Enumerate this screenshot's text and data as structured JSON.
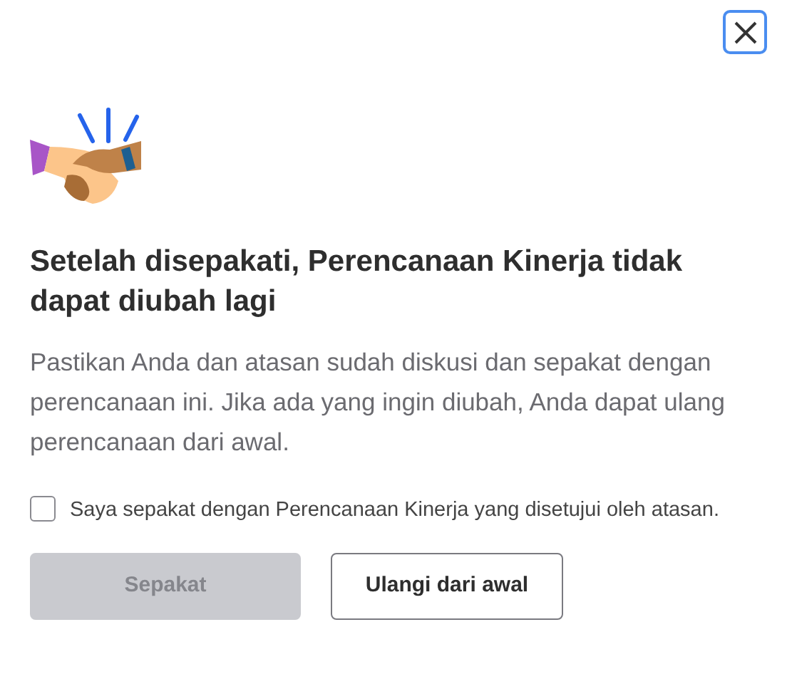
{
  "dialog": {
    "title": "Setelah disepakati, Perencanaan Kinerja tidak dapat diubah lagi",
    "description": "Pastikan Anda dan atasan sudah diskusi dan sepakat dengan perencanaan ini. Jika ada yang ingin diubah, Anda dapat ulang perencanaan dari awal.",
    "agreement": {
      "label": "Saya sepakat dengan Perencanaan Kinerja yang disetujui oleh atasan.",
      "checked": false
    },
    "buttons": [
      {
        "label": "Sepakat",
        "kind": "primary",
        "disabled": true
      },
      {
        "label": "Ulangi dari awal",
        "kind": "secondary",
        "disabled": false
      }
    ]
  }
}
